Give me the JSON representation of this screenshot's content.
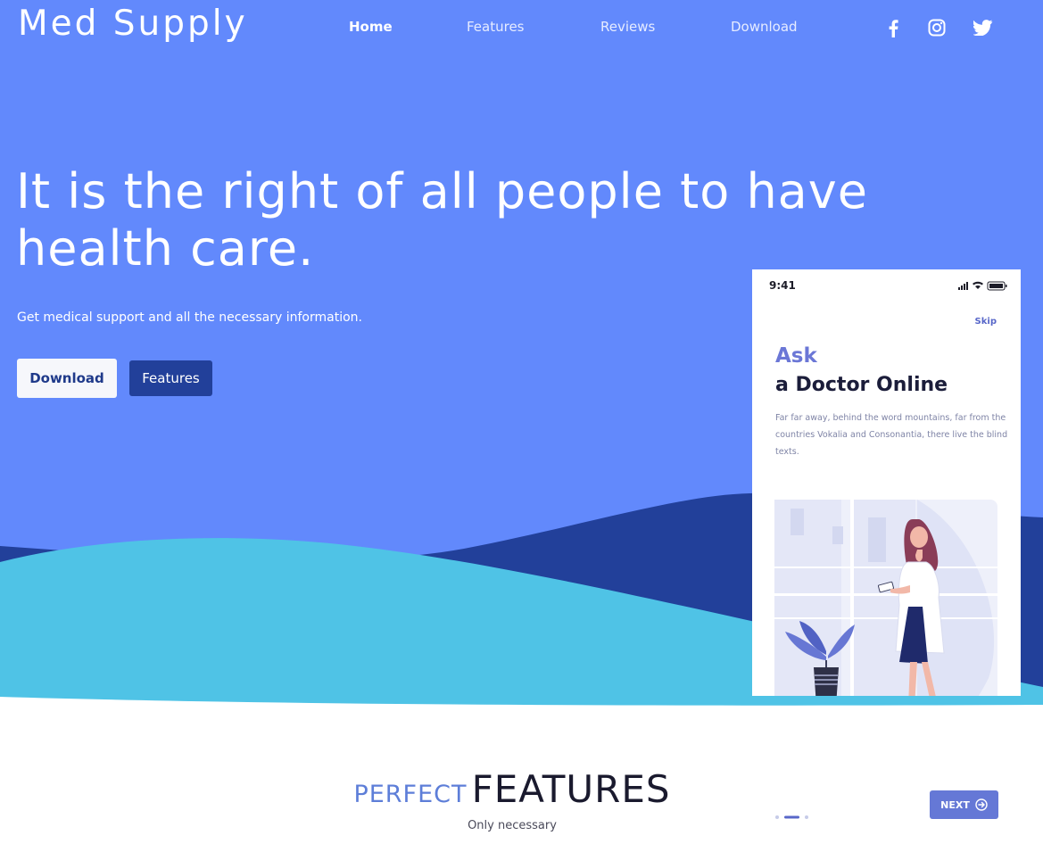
{
  "brand": {
    "logo": "Med Supply",
    "primary_color": "#6289fc",
    "dark_color": "#22409a",
    "wave_light": "#4fc3e6"
  },
  "nav": {
    "items": [
      {
        "label": "Home",
        "active": true
      },
      {
        "label": "Features",
        "active": false
      },
      {
        "label": "Reviews",
        "active": false
      },
      {
        "label": "Download",
        "active": false
      }
    ],
    "social": [
      "facebook-icon",
      "instagram-icon",
      "twitter-icon"
    ]
  },
  "hero": {
    "headline": "It is the right of all people to have health care.",
    "subline": "Get medical support and all the necessary information.",
    "download_label": "Download",
    "features_label": "Features"
  },
  "phone": {
    "time": "9:41",
    "skip": "Skip",
    "ask": "Ask",
    "title": "a Doctor Online",
    "desc": "Far far away, behind the word mountains, far from the countries Vokalia and Consonantia, there live the blind texts.",
    "next_label": "NEXT",
    "active_dot": 2,
    "dot_count": 3
  },
  "features": {
    "heading_light": "PERFECT",
    "heading_dark": "FEATURES",
    "subtitle": "Only necessary"
  }
}
